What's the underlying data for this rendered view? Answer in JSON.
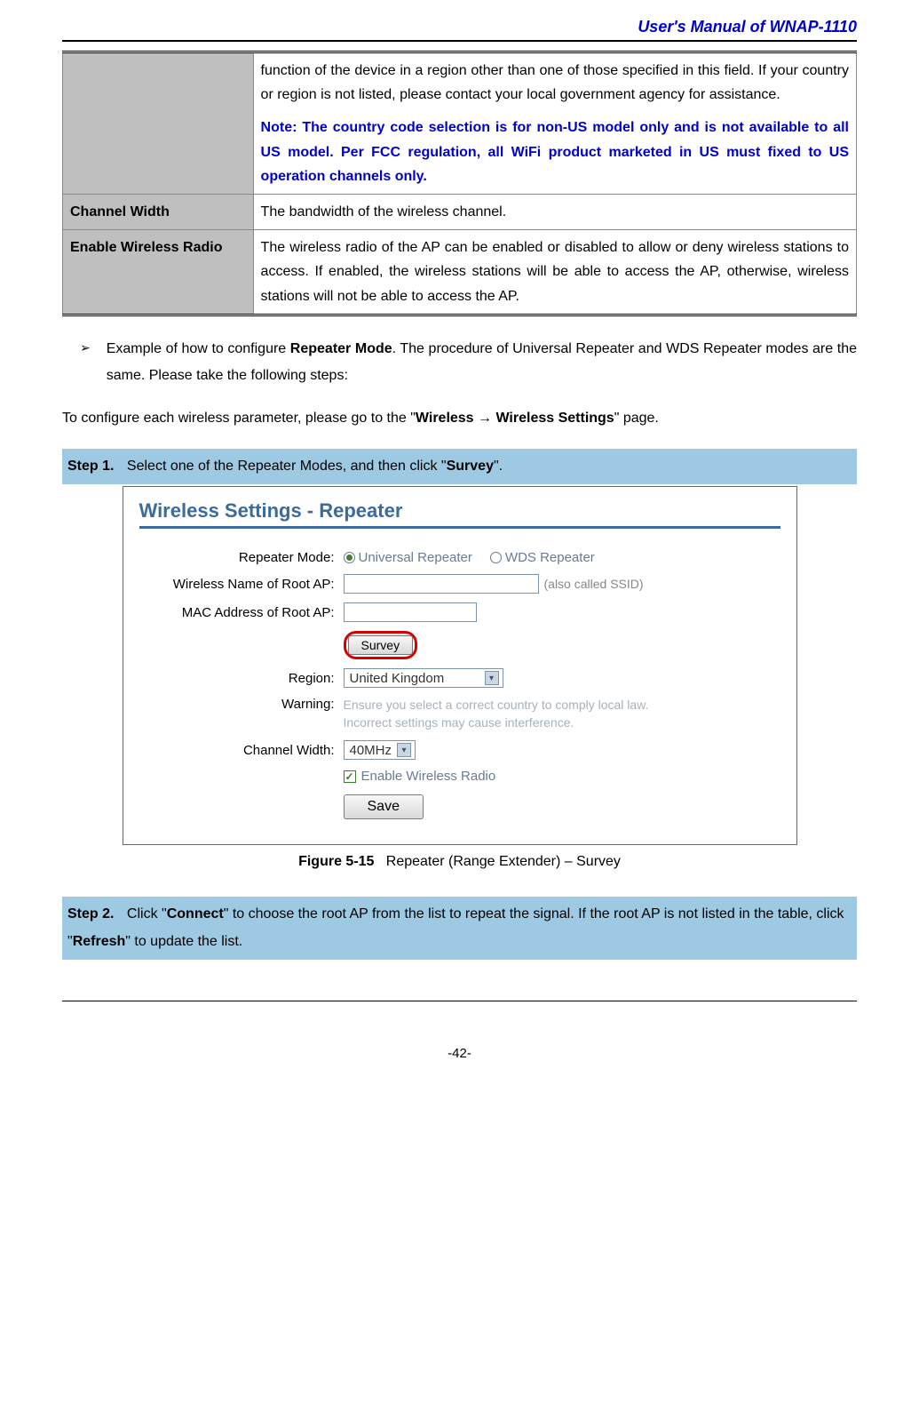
{
  "header": {
    "title": "User's  Manual  of  WNAP-1110"
  },
  "table": {
    "row1_desc": "function of the device in a region other than one of those specified in this field. If your country or region is not listed, please contact your local government agency for assistance.",
    "row1_note": "Note: The country code selection is for non-US model only and is not available to all US model. Per FCC regulation, all WiFi product marketed in US must fixed to US operation channels only.",
    "row2_label": "Channel Width",
    "row2_desc": "The bandwidth of the wireless channel.",
    "row3_label": "Enable Wireless Radio",
    "row3_desc": "The wireless radio of the AP can be enabled or disabled to allow or deny wireless stations to access. If enabled, the wireless stations will be able to access the AP, otherwise, wireless stations will not be able to access the AP."
  },
  "bullet_arrow": "➢",
  "bullet": {
    "pre": "Example of how to configure ",
    "bold1": "Repeater Mode",
    "post": ". The procedure of Universal Repeater and WDS Repeater modes are the same. Please take the following steps:"
  },
  "instruction": {
    "pre": "To configure each wireless parameter, please go to the \"",
    "bold": "Wireless → Wireless Settings",
    "post": "\" page."
  },
  "step1": {
    "label": "Step 1.",
    "pre": "Select one of the Repeater Modes, and then click \"",
    "bold": "Survey",
    "post": "\"."
  },
  "figure": {
    "title": "Wireless Settings - Repeater",
    "repeater_mode_label": "Repeater Mode:",
    "radio_universal": "Universal Repeater",
    "radio_wds": "WDS Repeater",
    "wireless_name_label": "Wireless Name of Root AP:",
    "ssid_hint": "(also called SSID)",
    "mac_label": "MAC Address of Root AP:",
    "survey_btn": "Survey",
    "region_label": "Region:",
    "region_value": "United Kingdom",
    "warning_label": "Warning:",
    "warning_text": "Ensure you select a correct country to comply local law. Incorrect settings may cause interference.",
    "channel_width_label": "Channel Width:",
    "channel_width_value": "40MHz",
    "enable_radio_label": "Enable Wireless Radio",
    "save_btn": "Save",
    "checkmark": "✓",
    "chevron": "▾"
  },
  "caption": {
    "bold": "Figure 5-15",
    "rest": "Repeater (Range Extender) – Survey"
  },
  "step2": {
    "label": "Step 2.",
    "pre": "Click \"",
    "bold1": "Connect",
    "mid": "\" to choose the root AP from the list to repeat the signal. If the root AP is not listed in the table, click \"",
    "bold2": "Refresh",
    "post": "\" to update the list."
  },
  "page_num": "-42-"
}
